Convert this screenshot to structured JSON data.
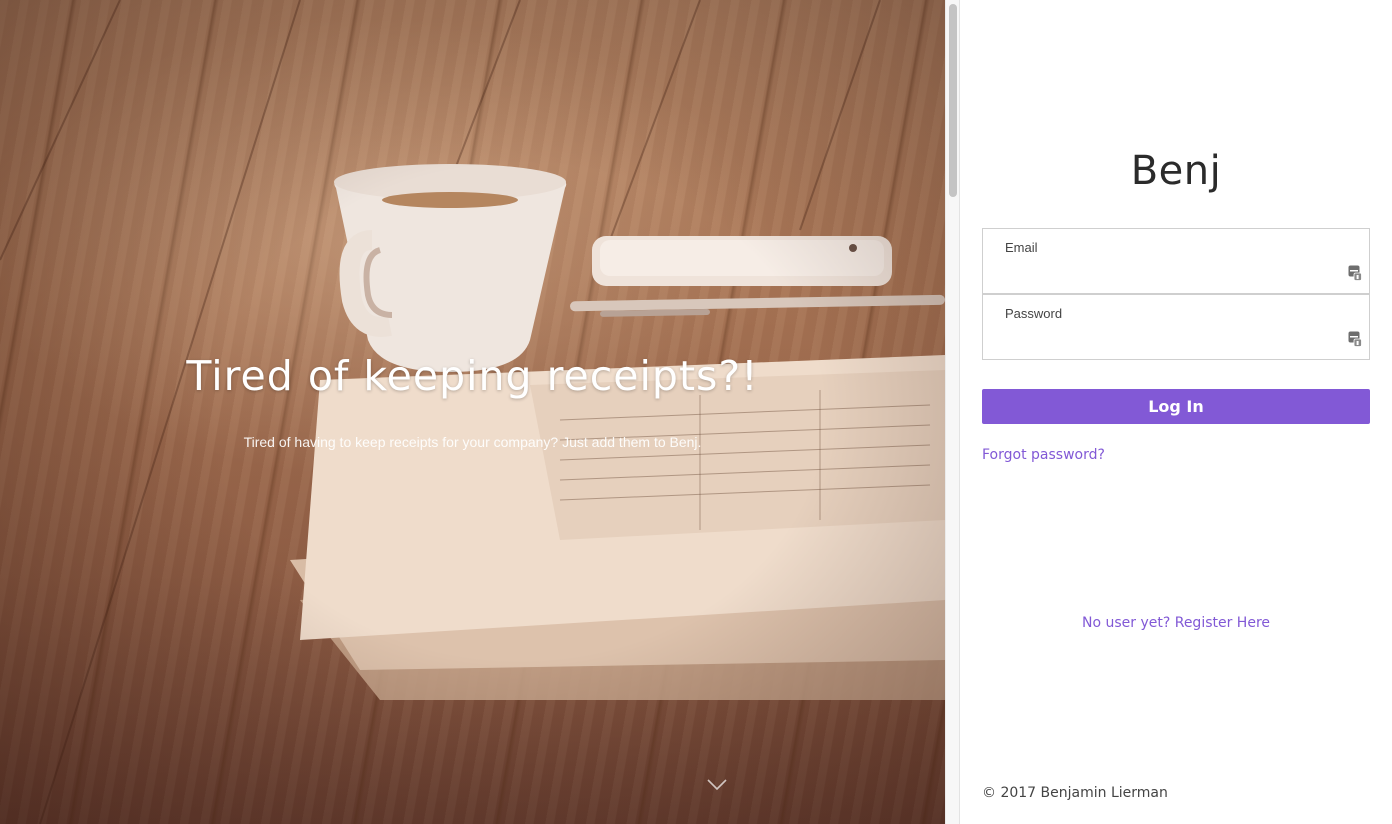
{
  "hero": {
    "title": "Tired of keeping receipts?!",
    "subtitle": "Tired of having to keep receipts for your company? Just add them to Benj.",
    "scroll_icon": "chevron-down-icon"
  },
  "login": {
    "brand": "Benj",
    "email_label": "Email",
    "email_value": "",
    "password_label": "Password",
    "password_value": "",
    "field_icon": "keychain-autofill-icon",
    "submit_label": "Log In",
    "forgot_label": "Forgot password?",
    "register_prefix": "No user yet?",
    "register_link": "Register Here",
    "footer": "© 2017 Benjamin Lierman"
  },
  "colors": {
    "accent": "#8259d6",
    "text": "#2b2b2b",
    "border": "#cfcfcf"
  }
}
